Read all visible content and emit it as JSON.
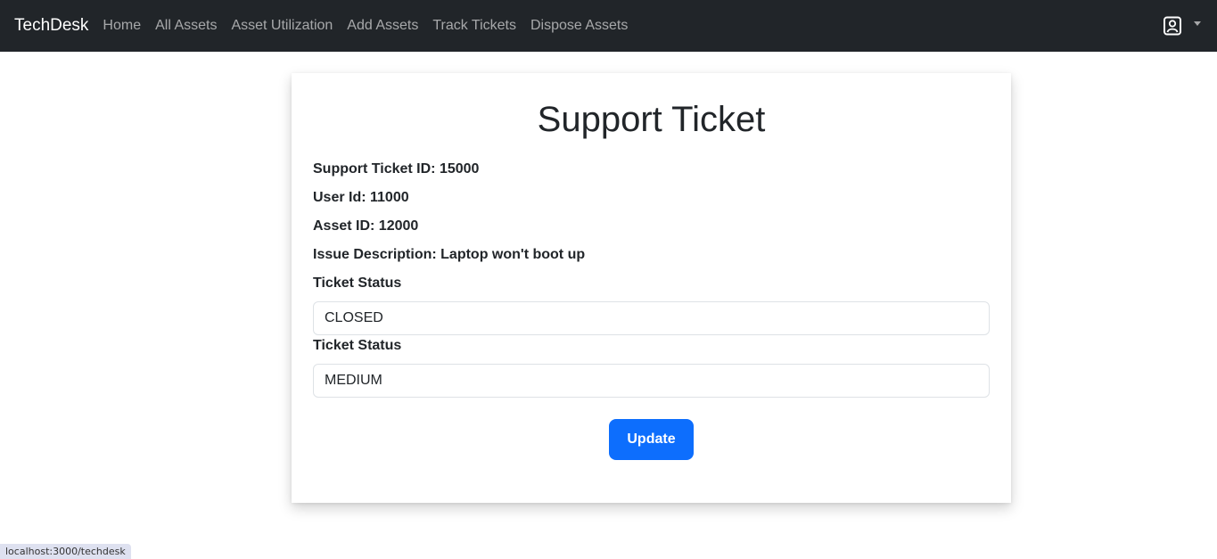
{
  "navbar": {
    "brand": "TechDesk",
    "links": [
      "Home",
      "All Assets",
      "Asset Utilization",
      "Add Assets",
      "Track Tickets",
      "Dispose Assets"
    ],
    "user_icon": "user-profile-icon",
    "dropdown_icon": "caret-down-icon"
  },
  "ticket": {
    "title": "Support Ticket",
    "id_line": "Support Ticket ID: 15000",
    "user_line": "User Id: 11000",
    "asset_line": "Asset ID: 12000",
    "issue_line": "Issue Description: Laptop won't boot up",
    "status_label": "Ticket Status",
    "status_value": "CLOSED",
    "priority_label": "Ticket Status",
    "priority_value": "MEDIUM",
    "update_label": "Update"
  },
  "statusbar": {
    "url": "localhost:3000/techdesk"
  },
  "colors": {
    "navbar_bg": "#212529",
    "primary": "#0d6efd"
  }
}
